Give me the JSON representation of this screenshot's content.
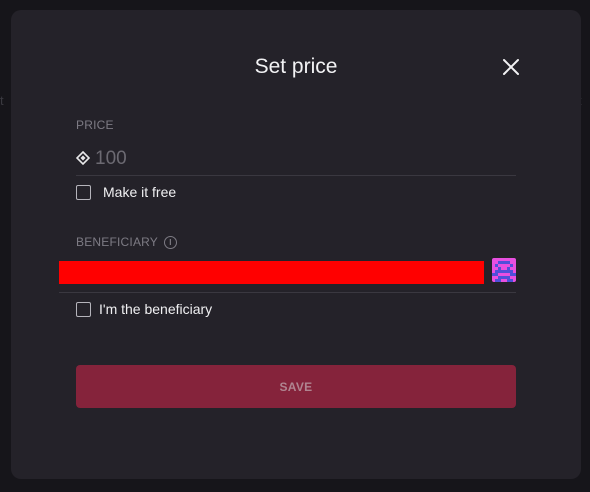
{
  "backdrop": {
    "left_fragment": "t",
    "right_fragment": "t"
  },
  "modal": {
    "title": "Set price"
  },
  "price": {
    "label": "PRICE",
    "placeholder": "100",
    "value": ""
  },
  "free_option": {
    "label": "Make it free",
    "checked": false
  },
  "beneficiary": {
    "label": "BENEFICIARY",
    "info_icon_glyph": "i",
    "self_option_label": "I'm the beneficiary",
    "self_option_checked": false
  },
  "actions": {
    "save_label": "SAVE"
  },
  "colors": {
    "modal_bg": "#242229",
    "save_button_bg": "#85233b",
    "redaction": "#ff0000",
    "avatar_primary": "#e84fe0",
    "avatar_secondary": "#4f4fd9"
  },
  "icons": {
    "close": "close-icon",
    "currency": "diamond-icon",
    "info": "info-icon"
  }
}
